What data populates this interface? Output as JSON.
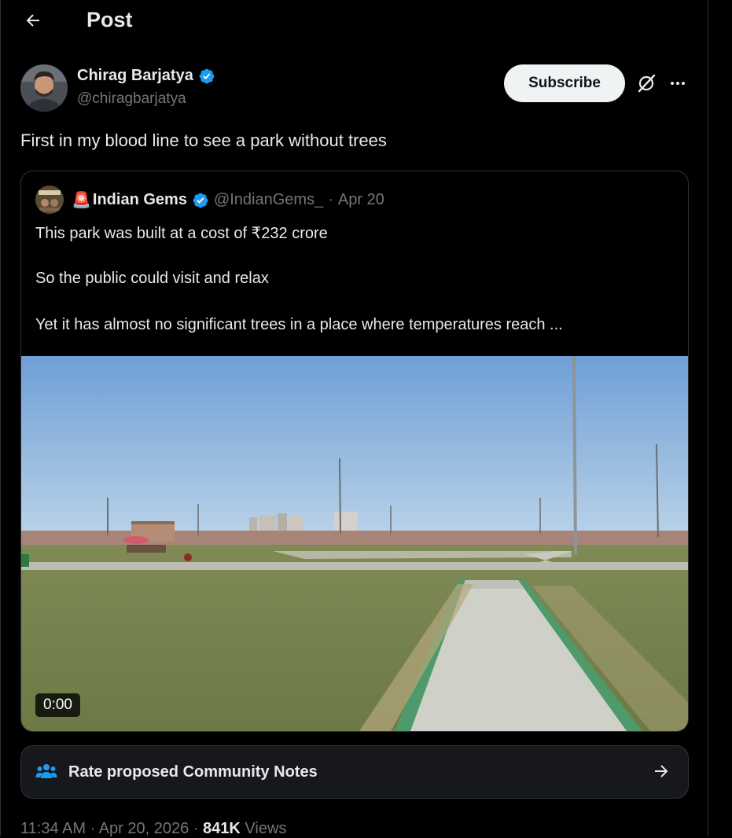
{
  "header": {
    "title": "Post"
  },
  "author": {
    "name": "Chirag Barjatya",
    "handle": "@chiragbarjatya",
    "verified": true
  },
  "actions": {
    "subscribe_label": "Subscribe"
  },
  "post": {
    "text": "First in my blood line to see a park without trees"
  },
  "quote": {
    "emoji": "🚨",
    "name": "Indian Gems",
    "handle": "@IndianGems_",
    "separator": "·",
    "date": "Apr 20",
    "lines": [
      "This park was built at a cost of ₹232 crore",
      "So the public could visit and relax",
      "Yet it has almost no significant trees in a place where temperatures reach ..."
    ],
    "video_time": "0:00"
  },
  "community_notes": {
    "label": "Rate proposed Community Notes"
  },
  "meta": {
    "time": "11:34 AM",
    "sep1": "·",
    "date": "Apr 20, 2026",
    "sep2": "·",
    "views_count": "841K",
    "views_label": "Views"
  },
  "colors": {
    "background": "#000000",
    "text": "#e7e9ea",
    "muted": "#71767b",
    "verified": "#1d9bf0",
    "border": "#2f3336",
    "subscribe_bg": "#eff3f4"
  },
  "icons": [
    "back-arrow-icon",
    "verified-badge-icon",
    "grok-icon",
    "more-icon",
    "community-notes-icon",
    "arrow-right-icon",
    "siren-emoji"
  ]
}
